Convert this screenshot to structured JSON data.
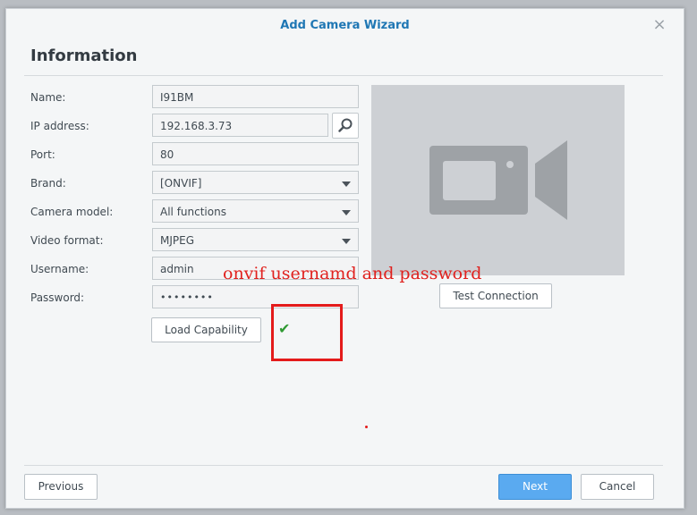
{
  "dialog": {
    "title": "Add Camera Wizard",
    "close_icon": "×",
    "heading": "Information"
  },
  "form": {
    "name_label": "Name:",
    "name_value": "I91BM",
    "ip_label": "IP address:",
    "ip_value": "192.168.3.73",
    "port_label": "Port:",
    "port_value": "80",
    "brand_label": "Brand:",
    "brand_value": "[ONVIF]",
    "model_label": "Camera model:",
    "model_value": "All functions",
    "video_format_label": "Video format:",
    "video_format_value": "MJPEG",
    "username_label": "Username:",
    "username_value": "admin",
    "password_label": "Password:",
    "password_value": "••••••••"
  },
  "buttons": {
    "load_capability": "Load Capability",
    "test_connection": "Test Connection",
    "previous": "Previous",
    "next": "Next",
    "cancel": "Cancel"
  },
  "annotation": {
    "text": "onvif usernamd and password",
    "color": "#e0211e"
  },
  "status": {
    "check_icon": "✔"
  },
  "icons": {
    "search": "search-icon",
    "camera": "video-camera-icon",
    "dropdown": "chevron-down-icon"
  },
  "colors": {
    "title": "#1f77b4",
    "primary_button": "#5aaaf0",
    "annotation_box": "#e41b1b",
    "check": "#2e9a32"
  }
}
